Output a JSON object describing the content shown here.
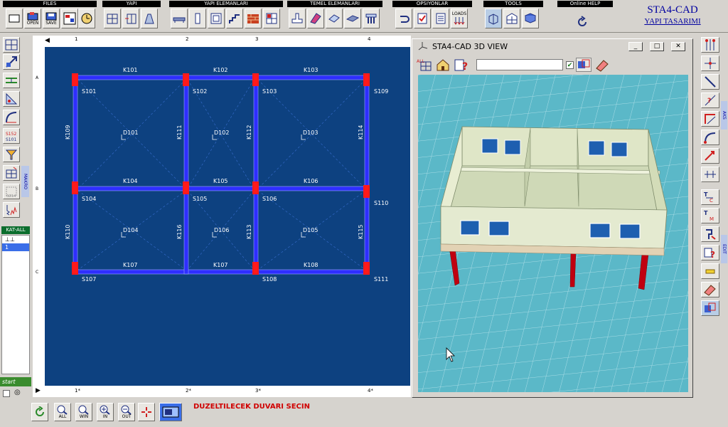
{
  "app": {
    "brand_title": "STA4-CAD",
    "brand_subtitle": "YAPI TASARIMI"
  },
  "toolbar": {
    "groups": [
      {
        "title": "FILES",
        "buttons": [
          "",
          "OPEN",
          "SAVE",
          "",
          ""
        ]
      },
      {
        "title": "YAPI",
        "buttons": [
          "",
          "",
          ""
        ]
      },
      {
        "title": "YAPI ELEMANLARI",
        "buttons": [
          "",
          "",
          "",
          "",
          "",
          ""
        ]
      },
      {
        "title": "TEMEL ELEMANLARI",
        "buttons": [
          "",
          "",
          "",
          "",
          ""
        ]
      },
      {
        "title": "OPSIYONLAR",
        "buttons": [
          "",
          "",
          "",
          "LOADS"
        ]
      },
      {
        "title": "TOOLS",
        "buttons": [
          "",
          "",
          ""
        ]
      },
      {
        "title": "Online HELP",
        "buttons": []
      }
    ]
  },
  "left_panel": {
    "makro_label": "MAKRO",
    "storey_header": "KAT-ALL",
    "storeys": [
      "⊥⊥",
      "1"
    ],
    "start_label": "start"
  },
  "plan": {
    "rulers_top": [
      "1",
      "2",
      "3",
      "4"
    ],
    "rulers_bottom": [
      "1*",
      "2*",
      "3*",
      "4*"
    ],
    "rulers_left": [
      "A",
      "B",
      "C"
    ],
    "beams": [
      "K101",
      "K102",
      "K103",
      "K104",
      "K105",
      "K106",
      "K107",
      "K107",
      "K108",
      "K109",
      "K111",
      "K112",
      "K114",
      "K110",
      "K116",
      "K113",
      "K115"
    ],
    "columns": [
      "S101",
      "S102",
      "S103",
      "S109",
      "S104",
      "S105",
      "S106",
      "S110",
      "S107",
      "S108",
      "S111"
    ],
    "slabs": [
      "D101",
      "D102",
      "D103",
      "D104",
      "D106",
      "D105"
    ]
  },
  "view3d": {
    "title": "STA4-CAD  3D VIEW",
    "combo_value": "",
    "checkbox_checked": true
  },
  "right_panel": {
    "aks_label": "AKS",
    "edit_label": "EDIT"
  },
  "bottom": {
    "buttons": [
      "",
      "ALL",
      "WIN",
      "IN",
      "OUT",
      "",
      ""
    ],
    "status_text": "DUZELTILECEK DUVARI SECIN"
  },
  "colors": {
    "plan_background": "#0d4180",
    "beam": "#2e2eff",
    "column": "#ff1a1a",
    "view_background": "#5bb8c8",
    "status_text": "#d00000",
    "brand": "#0000a0"
  }
}
